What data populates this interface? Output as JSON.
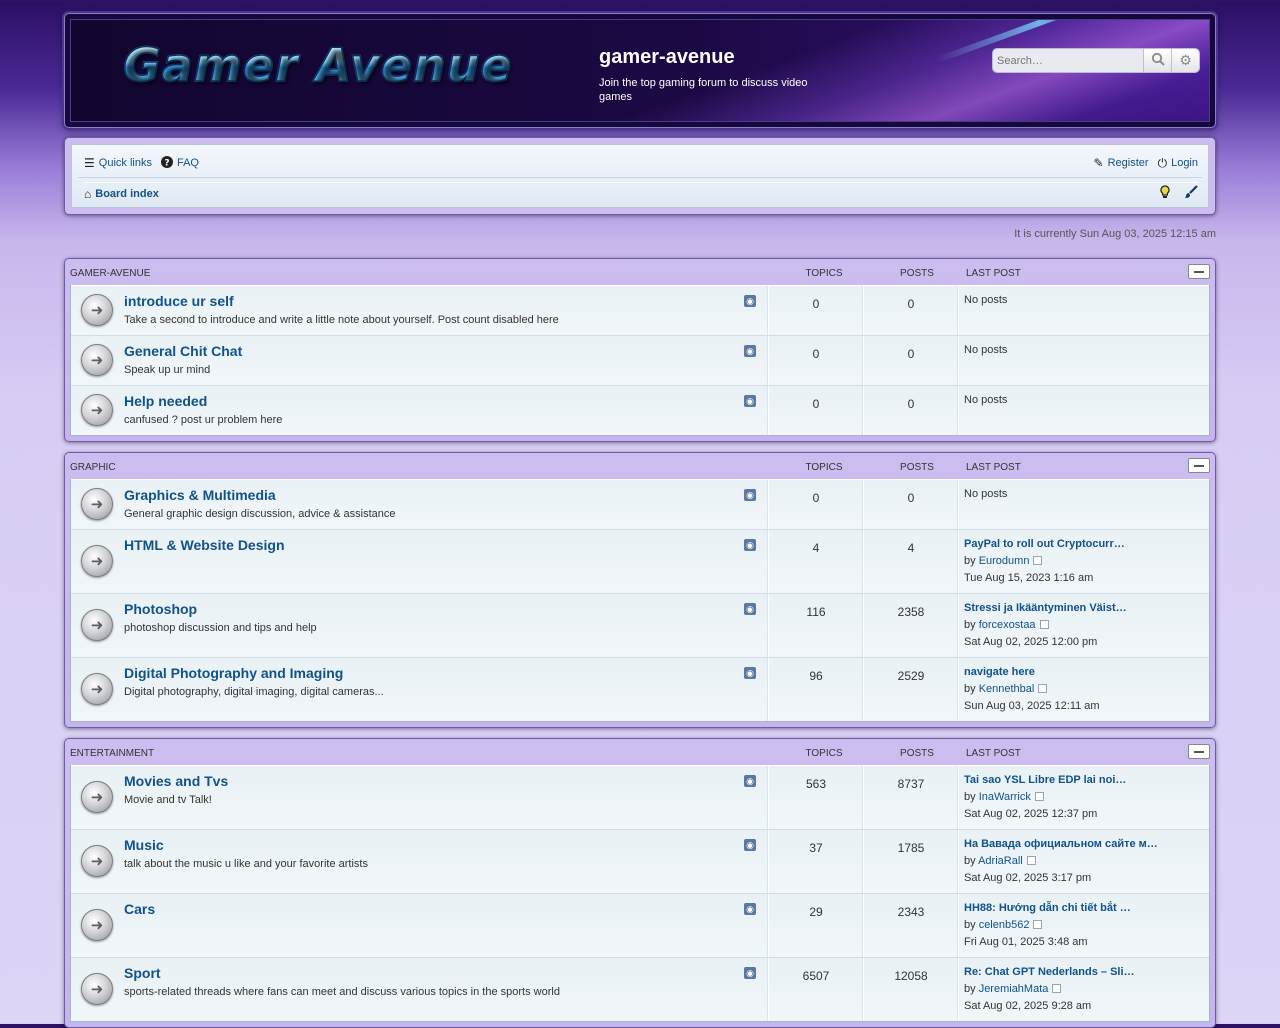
{
  "header": {
    "logo_text": "Gamer Avenue",
    "site_name": "gamer-avenue",
    "site_description": "Join the top gaming forum to discuss video games",
    "search_placeholder": "Search…"
  },
  "nav": {
    "quick_links": "Quick links",
    "faq": "FAQ",
    "register": "Register",
    "login": "Login",
    "board_index": "Board index"
  },
  "timestamp": "It is currently Sun Aug 03, 2025 12:15 am",
  "columns": {
    "topics": "TOPICS",
    "posts": "POSTS",
    "last_post": "LAST POST"
  },
  "categories": [
    {
      "title": "GAMER-AVENUE",
      "forums": [
        {
          "title": "introduce ur self",
          "desc": "Take a second to introduce and write a little note about yourself. Post count disabled here",
          "topics": "0",
          "posts": "0",
          "last_title": "No posts",
          "last_by_label": "",
          "last_by": "",
          "last_date": ""
        },
        {
          "title": "General Chit Chat",
          "desc": "Speak up ur mind",
          "topics": "0",
          "posts": "0",
          "last_title": "No posts",
          "last_by_label": "",
          "last_by": "",
          "last_date": ""
        },
        {
          "title": "Help needed",
          "desc": "canfused ? post ur problem here",
          "topics": "0",
          "posts": "0",
          "last_title": "No posts",
          "last_by_label": "",
          "last_by": "",
          "last_date": ""
        }
      ]
    },
    {
      "title": "GRAPHIC",
      "forums": [
        {
          "title": "Graphics & Multimedia",
          "desc": "General graphic design discussion, advice & assistance",
          "topics": "0",
          "posts": "0",
          "last_title": "No posts",
          "last_by_label": "",
          "last_by": "",
          "last_date": ""
        },
        {
          "title": "HTML & Website Design",
          "desc": "",
          "topics": "4",
          "posts": "4",
          "last_title": "PayPal to roll out Cryptocurr…",
          "last_by_label": "by",
          "last_by": "Eurodumn",
          "last_date": "Tue Aug 15, 2023 1:16 am"
        },
        {
          "title": "Photoshop",
          "desc": "photoshop discussion and tips and help",
          "topics": "116",
          "posts": "2358",
          "last_title": "Stressi ja Ikääntyminen Väist…",
          "last_by_label": "by",
          "last_by": "forcexostaa",
          "last_date": "Sat Aug 02, 2025 12:00 pm"
        },
        {
          "title": "Digital Photography and Imaging",
          "desc": "Digital photography, digital imaging, digital cameras...",
          "topics": "96",
          "posts": "2529",
          "last_title": "navigate here",
          "last_by_label": "by",
          "last_by": "Kennethbal",
          "last_date": "Sun Aug 03, 2025 12:11 am"
        }
      ]
    },
    {
      "title": "ENTERTAINMENT",
      "forums": [
        {
          "title": "Movies and Tvs",
          "desc": "Movie and tv Talk!",
          "topics": "563",
          "posts": "8737",
          "last_title": "Tai sao YSL Libre EDP lai noi…",
          "last_by_label": "by",
          "last_by": "InaWarrick",
          "last_date": "Sat Aug 02, 2025 12:37 pm"
        },
        {
          "title": "Music",
          "desc": "talk about the music u like and your favorite artists",
          "topics": "37",
          "posts": "1785",
          "last_title": "На Вавада официальном сайте м…",
          "last_by_label": "by",
          "last_by": "AdriaRall",
          "last_date": "Sat Aug 02, 2025 3:17 pm"
        },
        {
          "title": "Cars",
          "desc": "",
          "topics": "29",
          "posts": "2343",
          "last_title": "HH88: Hướng dẫn chi tiết bắt …",
          "last_by_label": "by",
          "last_by": "celenb562",
          "last_date": "Fri Aug 01, 2025 3:48 am"
        },
        {
          "title": "Sport",
          "desc": "sports-related threads where fans can meet and discuss various topics in the sports world",
          "topics": "6507",
          "posts": "12058",
          "last_title": "Re: Chat GPT Nederlands – Sli…",
          "last_by_label": "by",
          "last_by": "JeremiahMata",
          "last_date": "Sat Aug 02, 2025 9:28 am"
        }
      ]
    }
  ]
}
